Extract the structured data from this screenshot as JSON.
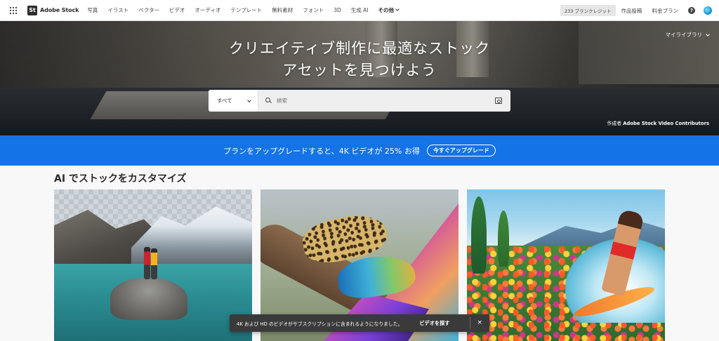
{
  "topnav": {
    "logo_badge": "St",
    "logo_text": "Adobe Stock",
    "items": [
      "写真",
      "イラスト",
      "ベクター",
      "ビデオ",
      "オーディオ",
      "テンプレート",
      "無料素材",
      "フォント",
      "3D",
      "生成 AI"
    ],
    "more_label": "その他",
    "credits": "233 プランクレジット",
    "contribute": "作品投稿",
    "pricing": "料金プラン",
    "help_glyph": "?"
  },
  "hero": {
    "title_line1": "クリエイティブ制作に最適なストック",
    "title_line2": "アセットを見つけよう",
    "my_library": "マイライブラリ",
    "search": {
      "category": "すべて",
      "placeholder": "検索"
    },
    "credit_prefix": "作成者",
    "credit_name": "Adobe Stock Video Contributors"
  },
  "promo": {
    "text": "プランをアップグレードすると、4K ビデオが 25% お得",
    "button": "今すぐアップグレード"
  },
  "section": {
    "title": "AI でストックをカスタマイズ"
  },
  "toast": {
    "message": "4K および HD のビデオがサブスクリプションに含まれるようになりました。",
    "action": "ビデオを探す",
    "close": "×"
  },
  "colors": {
    "accent": "#1473e6",
    "toast_bg": "#3a3a3a",
    "nav_bg": "#ffffff"
  },
  "icons": {
    "apps": "apps-grid-icon",
    "search": "search-icon",
    "visual_search": "visual-search-icon",
    "help": "help-icon",
    "close": "close-icon"
  }
}
